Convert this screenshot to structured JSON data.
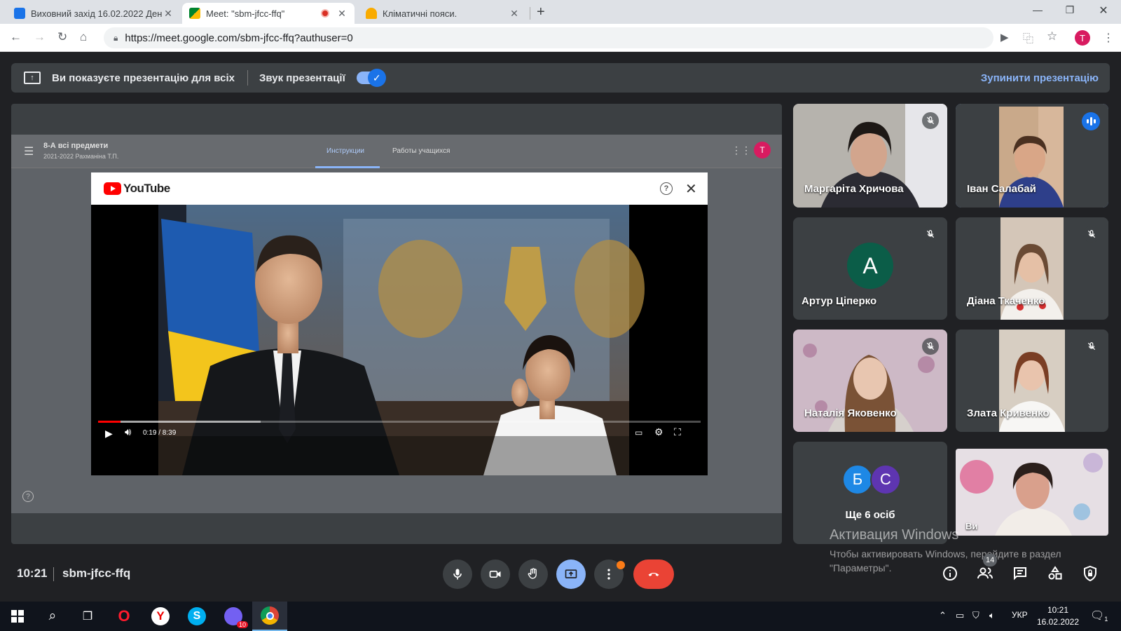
{
  "browser": {
    "tabs": [
      {
        "title": "Виховний захід 16.02.2022 Ден",
        "active": false
      },
      {
        "title": "Meet: \"sbm-jfcc-ffq\"",
        "active": true,
        "recording": true
      },
      {
        "title": "Кліматичні пояси.",
        "active": false
      }
    ],
    "url": "https://meet.google.com/sbm-jfcc-ffq?authuser=0",
    "profile_initial": "T"
  },
  "banner": {
    "presenting_text": "Ви показуєте презентацію для всіх",
    "audio_label": "Звук презентації",
    "audio_on": true,
    "stop_label": "Зупинити презентацію"
  },
  "classroom": {
    "course_title": "8-А всі предмети",
    "course_subtitle": "2021-2022 Рахманіна Т.П.",
    "tabs": [
      "Инструкции",
      "Работы учащихся"
    ],
    "active_tab": "Инструкции",
    "avatar_initial": "T"
  },
  "youtube": {
    "brand": "YouTube",
    "time": "0:19 / 8:39",
    "progress_fraction": 0.037,
    "buffered_fraction": 0.27
  },
  "participants": [
    {
      "name": "Маргаріта Хричова",
      "muted": true,
      "speaking": false
    },
    {
      "name": "Іван Салабай",
      "muted": false,
      "speaking": true
    },
    {
      "name": "Артур Ціперко",
      "muted": true,
      "letter": "A",
      "color": "#0b5d48"
    },
    {
      "name": "Діана Ткаченко",
      "muted": true
    },
    {
      "name": "Наталія Яковенко",
      "muted": true
    },
    {
      "name": "Злата Кривенко",
      "muted": true
    }
  ],
  "others": {
    "label": "Ще 6 осіб",
    "avatars": [
      {
        "letter": "Б",
        "color": "#1e88e5"
      },
      {
        "letter": "С",
        "color": "#5e35b1"
      }
    ]
  },
  "self_tile": {
    "name": "Ви"
  },
  "windows_activation": {
    "title": "Активация Windows",
    "text": "Чтобы активировать Windows, перейдите в раздел \"Параметры\"."
  },
  "meeting": {
    "time": "10:21",
    "code": "sbm-jfcc-ffq",
    "people_count": "14"
  },
  "taskbar": {
    "language": "УКР",
    "clock_time": "10:21",
    "clock_date": "16.02.2022",
    "viber_badge": "10",
    "notification_count": "1"
  }
}
